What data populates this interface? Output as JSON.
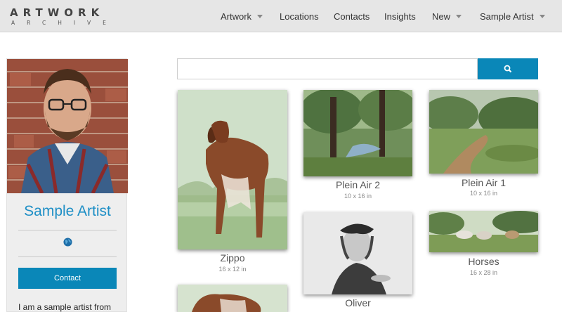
{
  "header": {
    "logo_main": "ARTWORK",
    "logo_sub": "ARCHIVE",
    "nav": [
      {
        "label": "Artwork",
        "dropdown": true
      },
      {
        "label": "Locations",
        "dropdown": false
      },
      {
        "label": "Contacts",
        "dropdown": false
      },
      {
        "label": "Insights",
        "dropdown": false
      },
      {
        "label": "New",
        "dropdown": true
      },
      {
        "label": "Sample Artist",
        "dropdown": true
      }
    ]
  },
  "profile": {
    "name": "Sample Artist",
    "contact_label": "Contact",
    "bio": "I am a sample artist from",
    "website_icon": "globe-icon"
  },
  "search": {
    "placeholder": "",
    "button_icon": "search-icon"
  },
  "artworks": [
    {
      "title": "Zippo",
      "dims": "16 x 12 in"
    },
    {
      "title": "Plein Air 2",
      "dims": "10 x 16 in"
    },
    {
      "title": "Plein Air 1",
      "dims": "10 x 16 in"
    },
    {
      "title": "Oliver",
      "dims": ""
    },
    {
      "title": "Horses",
      "dims": "16 x 28 in"
    },
    {
      "title": "",
      "dims": ""
    }
  ],
  "colors": {
    "accent": "#0a87b8",
    "artist_name": "#1e8fc6",
    "header_bg": "#e6e6e6"
  }
}
